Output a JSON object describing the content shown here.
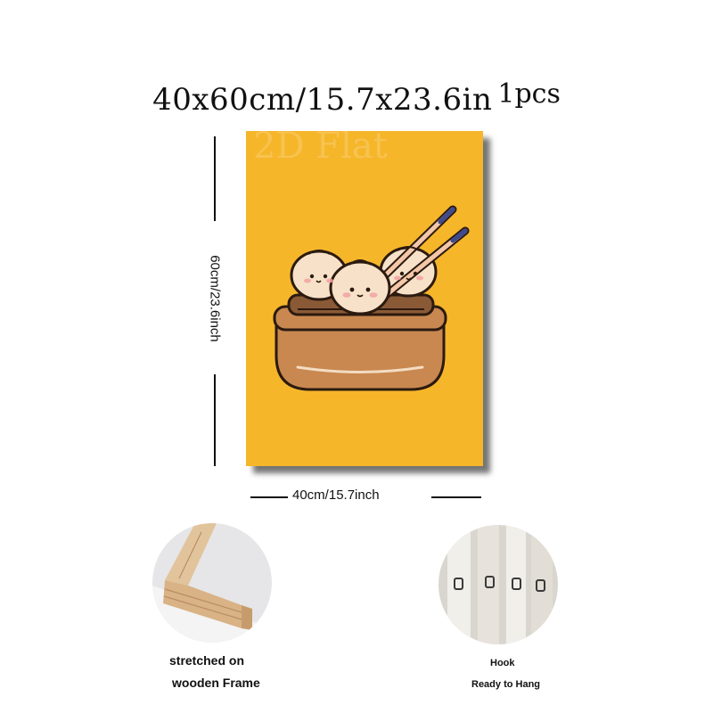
{
  "title": {
    "size": "40x60cm/15.7x23.6in",
    "quantity": "1pcs"
  },
  "poster": {
    "watermark": "2D Flat",
    "background": "#f6b62a",
    "artwork": "steamed-dumplings-basket-with-chopsticks"
  },
  "dimensions": {
    "height_label": "60cm/23.6inch",
    "width_label": "40cm/15.7inch"
  },
  "features": [
    {
      "name": "wooden-frame",
      "caption_lines": [
        "stretched on",
        "wooden Frame"
      ]
    },
    {
      "name": "hook",
      "caption_lines": [
        "Hook",
        "Ready to Hang"
      ]
    }
  ],
  "colors": {
    "poster_bg": "#f6b62a",
    "basket": "#c8884f",
    "dumpling": "#f7e2c9",
    "chopstick_tip": "#3f4a8f"
  }
}
